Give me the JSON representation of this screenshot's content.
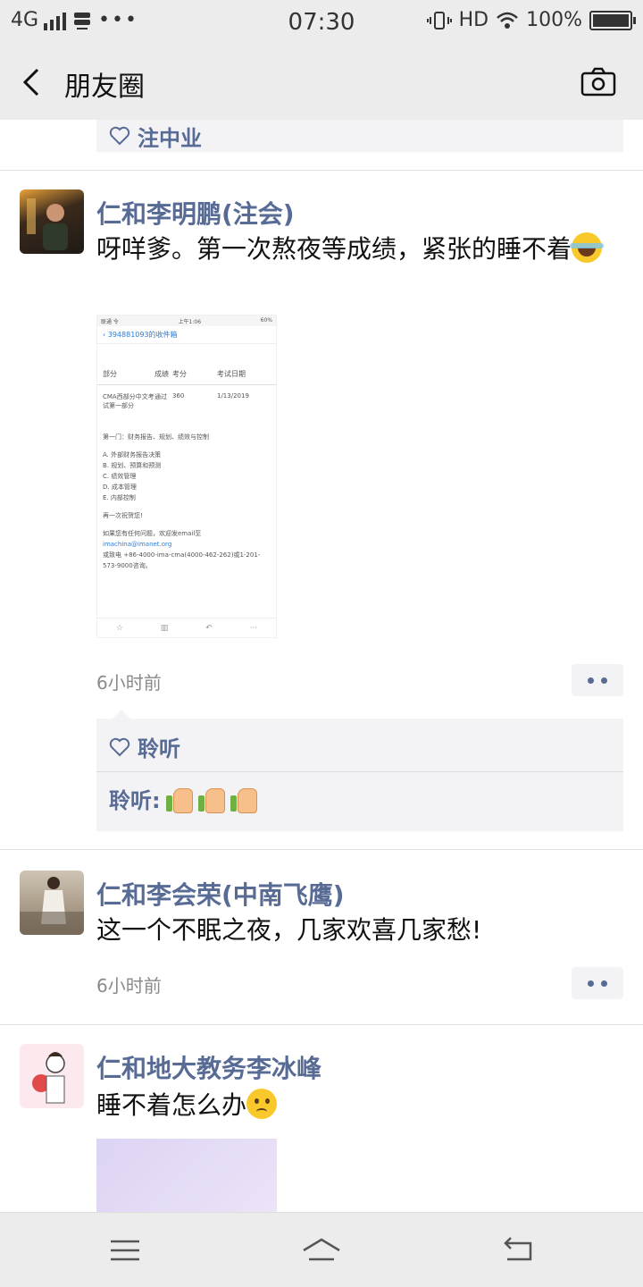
{
  "status_bar": {
    "network": "4G",
    "time": "07:30",
    "hd": "HD",
    "battery": "100%",
    "battery_level": 1.0
  },
  "nav": {
    "title": "朋友圈",
    "back_icon": "chevron-left-icon",
    "camera_icon": "camera-icon"
  },
  "previous_post": {
    "like_text": "注中业"
  },
  "posts": [
    {
      "author": "仁和李明鹏(注会)",
      "text": "呀咩爹。第一次熬夜等成绩，紧张的睡不着",
      "emoji": "laughing-tears-emoji",
      "time": "6小时前",
      "image": {
        "status_left": "联通 令",
        "status_time": "上午1:06",
        "status_right": "60%",
        "back_label": "394881093的收件箱",
        "headers": [
          "部分",
          "成绩",
          "考分",
          "考试日期"
        ],
        "row": [
          "CMA西部分中文考试第一部分",
          "通过",
          "360",
          "1/13/2019"
        ],
        "lines": [
          "第一门：财务报告、规划、绩效与控制",
          "A. 外部财务报告决策",
          "B. 规划、预算和预测",
          "C. 绩效管理",
          "D. 成本管理",
          "E. 内部控制",
          "再一次祝贺您!",
          "如果您有任何问题，欢迎发email至"
        ],
        "email": "imachina@imanet.org",
        "contact": "或致电 +86-4000-ima-cma(4000-462-262)或1-201-573-9000咨询。"
      },
      "likes": {
        "reaction_label": "聆听",
        "liker_label": "聆听:"
      }
    },
    {
      "author": "仁和李会荣(中南飞鹰)",
      "text": "这一个不眠之夜，几家欢喜几家愁!",
      "time": "6小时前"
    },
    {
      "author": "仁和地大教务李冰峰",
      "text": "睡不着怎么办",
      "emoji": "sad-face-emoji"
    }
  ],
  "bottom_nav": {
    "menu_icon": "menu-icon",
    "home_icon": "home-icon",
    "back_icon": "return-icon"
  }
}
